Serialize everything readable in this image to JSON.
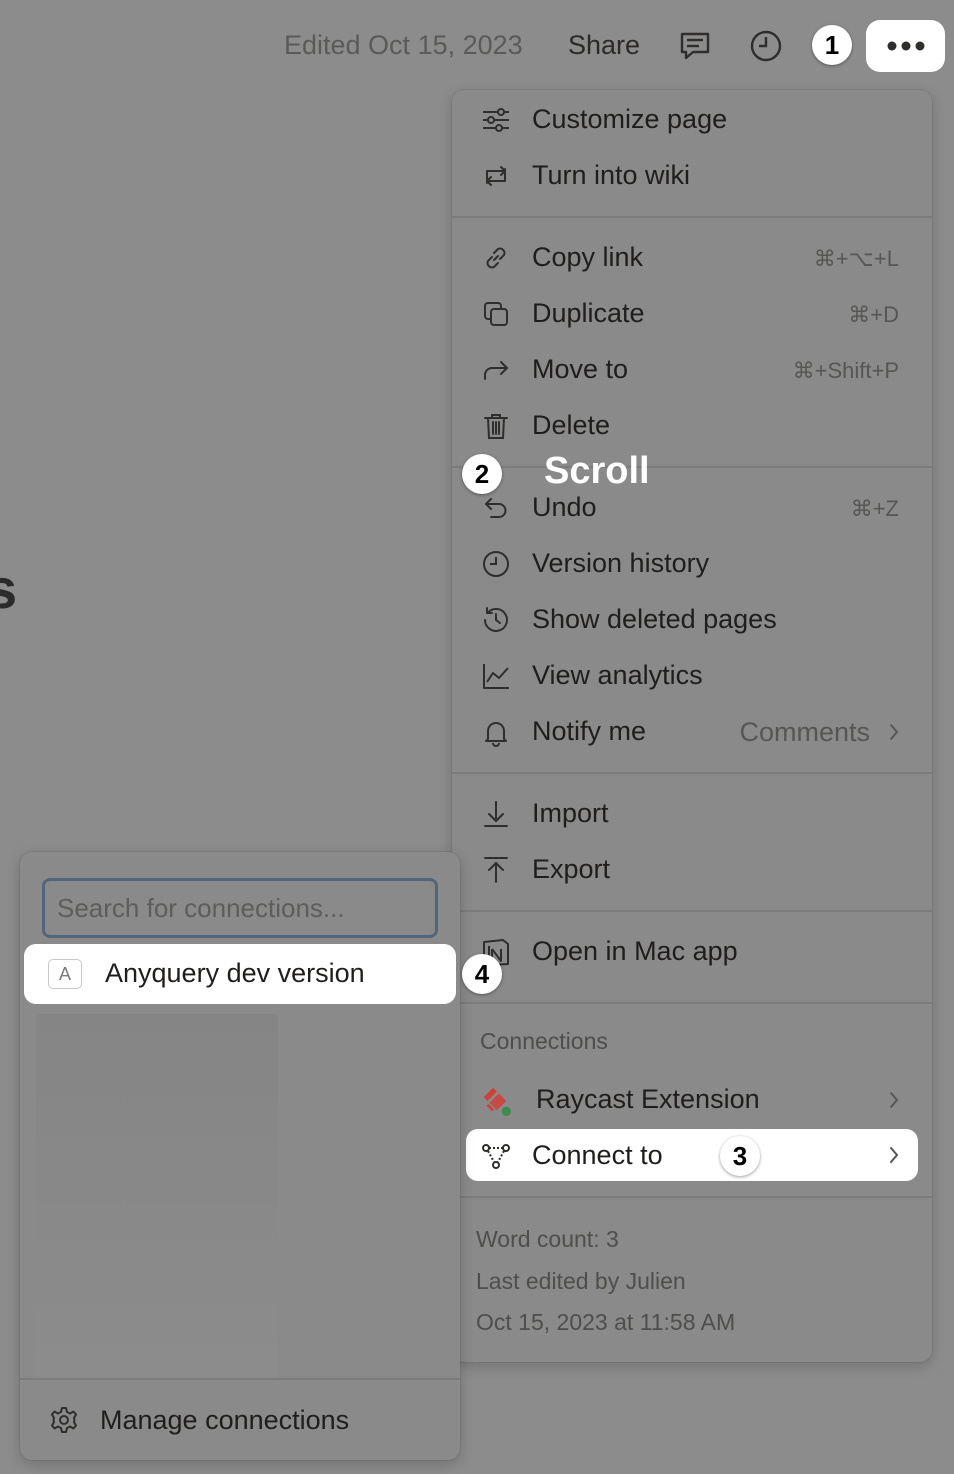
{
  "header": {
    "edited": "Edited Oct 15, 2023",
    "share": "Share"
  },
  "annotations": {
    "step1": "1",
    "step2": "2",
    "step3": "3",
    "step4": "4",
    "scroll": "Scroll"
  },
  "menu": {
    "customize": "Customize page",
    "wiki": "Turn into wiki",
    "copy_link": "Copy link",
    "copy_link_sc": "⌘+⌥+L",
    "duplicate": "Duplicate",
    "duplicate_sc": "⌘+D",
    "move_to": "Move to",
    "move_to_sc": "⌘+Shift+P",
    "delete": "Delete",
    "undo": "Undo",
    "undo_sc": "⌘+Z",
    "version_history": "Version history",
    "show_deleted": "Show deleted pages",
    "analytics": "View analytics",
    "notify": "Notify me",
    "notify_value": "Comments",
    "import": "Import",
    "export": "Export",
    "mac_app": "Open in Mac app",
    "connections_title": "Connections",
    "raycast": "Raycast Extension",
    "connect_to": "Connect to",
    "word_count": "Word count: 3",
    "last_edited_by": "Last edited by Julien",
    "last_edited_at": "Oct 15, 2023 at 11:58 AM"
  },
  "connections_panel": {
    "search_placeholder": "Search for connections...",
    "anyquery_letter": "A",
    "anyquery": "Anyquery dev version",
    "manage": "Manage connections"
  },
  "colors": {
    "overlay_bg": "#8c8c8c",
    "highlight": "#ffffff",
    "search_border": "#53657b",
    "raycast_red": "#d0403a",
    "status_green": "#3f8a4e"
  }
}
